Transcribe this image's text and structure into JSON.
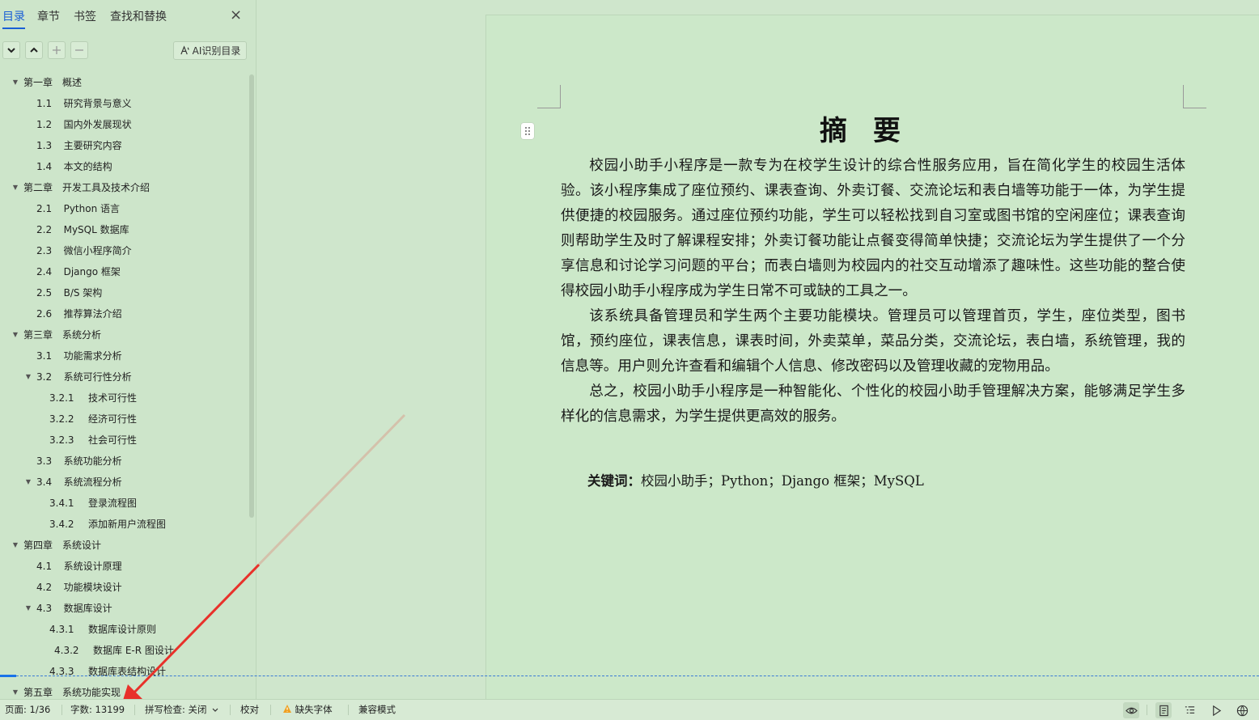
{
  "sidebar": {
    "tabs": [
      "目录",
      "章节",
      "书签",
      "查找和替换"
    ],
    "close_glyph": "×",
    "ai_button_label": "AI识别目录",
    "toc": [
      {
        "level": 0,
        "arrow": true,
        "num": "第一章",
        "title": "概述"
      },
      {
        "level": 1,
        "arrow": false,
        "num": "1.1",
        "title": "研究背景与意义"
      },
      {
        "level": 1,
        "arrow": false,
        "num": "1.2",
        "title": "国内外发展现状"
      },
      {
        "level": 1,
        "arrow": false,
        "num": "1.3",
        "title": "主要研究内容"
      },
      {
        "level": 1,
        "arrow": false,
        "num": "1.4",
        "title": "本文的结构"
      },
      {
        "level": 0,
        "arrow": true,
        "num": "第二章",
        "title": "开发工具及技术介绍"
      },
      {
        "level": 1,
        "arrow": false,
        "num": "2.1",
        "title": "Python 语言"
      },
      {
        "level": 1,
        "arrow": false,
        "num": "2.2",
        "title": "MySQL 数据库"
      },
      {
        "level": 1,
        "arrow": false,
        "num": "2.3",
        "title": "微信小程序简介"
      },
      {
        "level": 1,
        "arrow": false,
        "num": "2.4",
        "title": "Django 框架"
      },
      {
        "level": 1,
        "arrow": false,
        "num": "2.5",
        "title": "B/S 架构"
      },
      {
        "level": 1,
        "arrow": false,
        "num": "2.6",
        "title": "推荐算法介绍"
      },
      {
        "level": 0,
        "arrow": true,
        "num": "第三章",
        "title": "系统分析"
      },
      {
        "level": 1,
        "arrow": false,
        "num": "3.1",
        "title": "功能需求分析"
      },
      {
        "level": 1,
        "arrow": true,
        "num": "3.2",
        "title": "系统可行性分析"
      },
      {
        "level": 2,
        "arrow": false,
        "num": "3.2.1",
        "title": "技术可行性"
      },
      {
        "level": 2,
        "arrow": false,
        "num": "3.2.2",
        "title": "经济可行性"
      },
      {
        "level": 2,
        "arrow": false,
        "num": "3.2.3",
        "title": "社会可行性"
      },
      {
        "level": 1,
        "arrow": false,
        "num": "3.3",
        "title": "系统功能分析"
      },
      {
        "level": 1,
        "arrow": true,
        "num": "3.4",
        "title": "系统流程分析"
      },
      {
        "level": 2,
        "arrow": false,
        "num": "3.4.1",
        "title": "登录流程图"
      },
      {
        "level": 2,
        "arrow": false,
        "num": "3.4.2",
        "title": "添加新用户流程图"
      },
      {
        "level": 0,
        "arrow": true,
        "num": "第四章",
        "title": "系统设计"
      },
      {
        "level": 1,
        "arrow": false,
        "num": "4.1",
        "title": "系统设计原理"
      },
      {
        "level": 1,
        "arrow": false,
        "num": "4.2",
        "title": "功能模块设计"
      },
      {
        "level": 1,
        "arrow": true,
        "num": "4.3",
        "title": "数据库设计"
      },
      {
        "level": 2,
        "arrow": false,
        "num": "4.3.1",
        "title": "数据库设计原则"
      },
      {
        "level": 3,
        "arrow": false,
        "num": "4.3.2",
        "title": "数据库 E-R 图设计"
      },
      {
        "level": 2,
        "arrow": false,
        "num": "4.3.3",
        "title": "数据库表结构设计"
      },
      {
        "level": 0,
        "arrow": true,
        "num": "第五章",
        "title": "系统功能实现"
      }
    ]
  },
  "document": {
    "title": "摘要",
    "paragraphs": [
      "校园小助手小程序是一款专为在校学生设计的综合性服务应用，旨在简化学生的校园生活体验。该小程序集成了座位预约、课表查询、外卖订餐、交流论坛和表白墙等功能于一体，为学生提供便捷的校园服务。通过座位预约功能，学生可以轻松找到自习室或图书馆的空闲座位；课表查询则帮助学生及时了解课程安排；外卖订餐功能让点餐变得简单快捷；交流论坛为学生提供了一个分享信息和讨论学习问题的平台；而表白墙则为校园内的社交互动增添了趣味性。这些功能的整合使得校园小助手小程序成为学生日常不可或缺的工具之一。",
      "该系统具备管理员和学生两个主要功能模块。管理员可以管理首页，学生，座位类型，图书馆，预约座位，课表信息，课表时间，外卖菜单，菜品分类，交流论坛，表白墙，系统管理，我的信息等。用户则允许查看和编辑个人信息、修改密码以及管理收藏的宠物用品。",
      "总之，校园小助手小程序是一种智能化、个性化的校园小助手管理解决方案，能够满足学生多样化的信息需求，为学生提供更高效的服务。"
    ],
    "keywords_label": "关键词：",
    "keywords": "校园小助手；Python；Django 框架；MySQL"
  },
  "statusbar": {
    "page": "页面: 1/36",
    "words": "字数: 13199",
    "spell": "拼写检查: 关闭",
    "proof": "校对",
    "missing_font": "缺失字体",
    "compat": "兼容模式"
  },
  "colors": {
    "accent": "#1a5fd6",
    "background": "#cfe6cc",
    "arrow": "#e8312a"
  }
}
